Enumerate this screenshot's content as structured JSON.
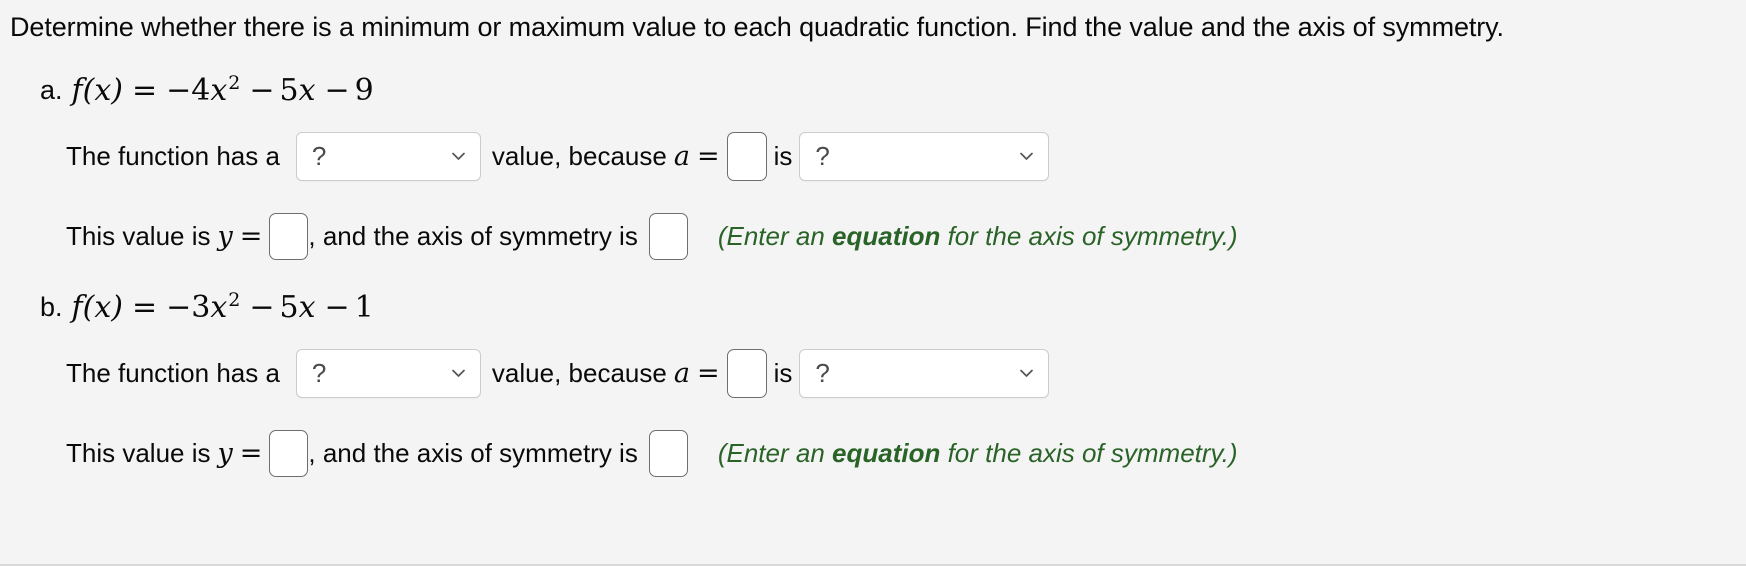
{
  "prompt": "Determine whether there is a minimum or maximum value to each quadratic function. Find the value and the axis of symmetry.",
  "dropdown_placeholder": "?",
  "chevron_icon": "chevron-down-icon",
  "hint": {
    "lead": "(Enter an ",
    "bold": "equation",
    "tail": " for the axis of symmetry.)"
  },
  "labels": {
    "function_has_a": "The function has a",
    "value_because": "value, because",
    "a_var": "a",
    "equals": "=",
    "is": "is",
    "this_value_is": "This value is",
    "y_var": "y",
    "comma_and_axis": ", and the axis of symmetry is"
  },
  "parts": [
    {
      "label": "a.",
      "equation": {
        "fx": "f(x)",
        "eq": "=",
        "term1_sign": "−",
        "term1_coef": "4",
        "term1_var": "x",
        "term1_exp": "2",
        "term2_sign": "−",
        "term2_coef": "5",
        "term2_var": "x",
        "term3_sign": "−",
        "term3_const": "9",
        "plain": "f(x) = −4x² − 5x − 9"
      },
      "minmax_select_value": "?",
      "a_input_value": "",
      "sign_select_value": "?",
      "y_input_value": "",
      "axis_input_value": ""
    },
    {
      "label": "b.",
      "equation": {
        "fx": "f(x)",
        "eq": "=",
        "term1_sign": "−",
        "term1_coef": "3",
        "term1_var": "x",
        "term1_exp": "2",
        "term2_sign": "−",
        "term2_coef": "5",
        "term2_var": "x",
        "term3_sign": "−",
        "term3_const": "1",
        "plain": "f(x) = −3x² − 5x − 1"
      },
      "minmax_select_value": "?",
      "a_input_value": "",
      "sign_select_value": "?",
      "y_input_value": "",
      "axis_input_value": ""
    }
  ]
}
